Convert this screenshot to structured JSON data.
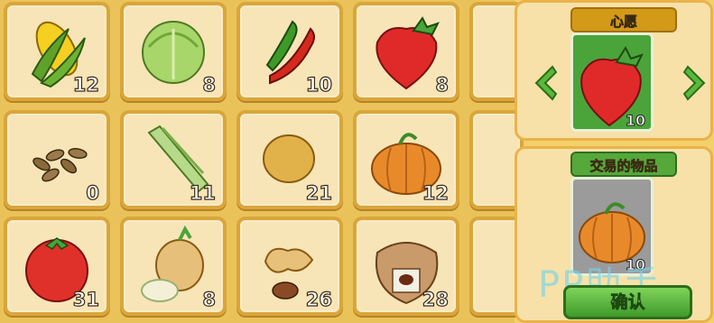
{
  "grid": {
    "slots": [
      {
        "item": "corn",
        "count": "12"
      },
      {
        "item": "cabbage",
        "count": "8"
      },
      {
        "item": "chili-pepper",
        "count": "10"
      },
      {
        "item": "strawberry",
        "count": "8"
      },
      {
        "item": "seeds",
        "count": "0"
      },
      {
        "item": "bamboo-shoot",
        "count": "11"
      },
      {
        "item": "potato",
        "count": "21"
      },
      {
        "item": "pumpkin",
        "count": "12"
      },
      {
        "item": "tomato",
        "count": "31"
      },
      {
        "item": "onion",
        "count": "8"
      },
      {
        "item": "peanut",
        "count": "26"
      },
      {
        "item": "coffee-bean-sack",
        "count": "28"
      }
    ]
  },
  "panel": {
    "wish_label": "心愿",
    "wish_item": "strawberry",
    "wish_count": "10",
    "trade_label": "交易的物品",
    "trade_item": "pumpkin",
    "trade_count": "10",
    "confirm_label": "确认"
  },
  "watermark": "PP助手",
  "colors": {
    "accent_green": "#56a83a",
    "slot_border": "#d9a63b",
    "wish_gold": "#d39a17"
  }
}
